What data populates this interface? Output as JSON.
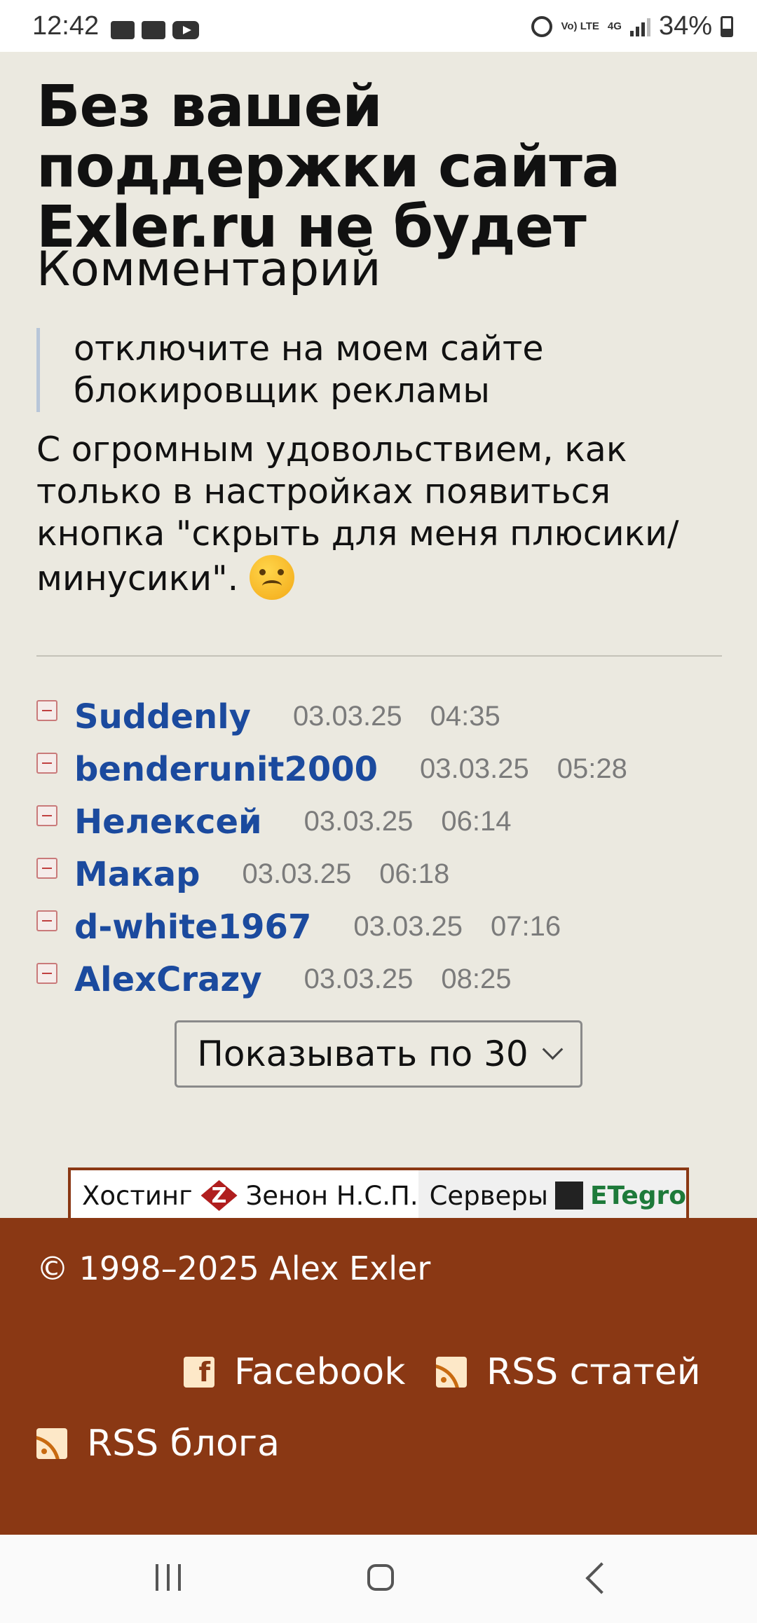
{
  "status": {
    "time": "12:42",
    "network": "Vo) LTE",
    "network_type": "4G",
    "battery": "34%"
  },
  "headline": "Без вашей поддержки сайта Exler.ru не будет",
  "comment": {
    "heading": "Комментарий",
    "quote": "отключите на моем сайте блокировщик рекламы",
    "body": "С огромным удовольствием, как только в настройках появиться кнопка \"скрыть для меня плюсики/минусики\"."
  },
  "votes": [
    {
      "user": "Suddenly",
      "date": "03.03.25",
      "time": "04:35"
    },
    {
      "user": "benderunit2000",
      "date": "03.03.25",
      "time": "05:28"
    },
    {
      "user": "Нелексей",
      "date": "03.03.25",
      "time": "06:14"
    },
    {
      "user": "Макар",
      "date": "03.03.25",
      "time": "06:18"
    },
    {
      "user": "d-white1967",
      "date": "03.03.25",
      "time": "07:16"
    },
    {
      "user": "AlexCrazy",
      "date": "03.03.25",
      "time": "08:25"
    }
  ],
  "pager": {
    "label": "Показывать по 30"
  },
  "hosting": {
    "hosting_label": "Хостинг",
    "hosting_name": "Зенон Н.С.П.",
    "servers_label": "Серверы",
    "servers_name": "ETegro"
  },
  "footer": {
    "copyright": "© 1998–2025 Alex Exler",
    "links": {
      "facebook": "Facebook",
      "rss_articles": "RSS статей",
      "rss_blog": "RSS блога"
    },
    "background_color": "#8a3814"
  },
  "colors": {
    "page_bg": "#ebe9e0",
    "user_link": "#1b4a9e",
    "meta_text": "#7b7b7b"
  }
}
